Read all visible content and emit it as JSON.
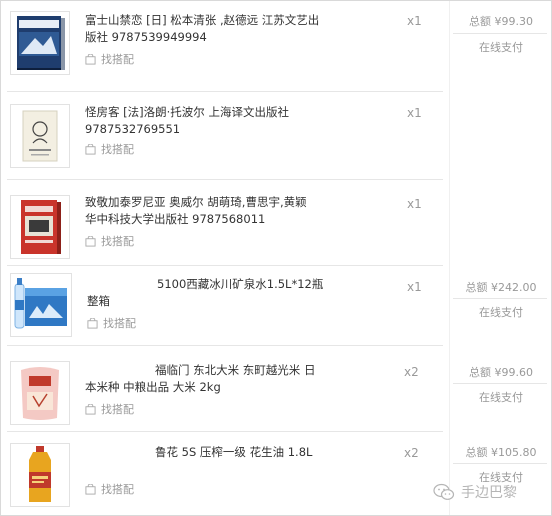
{
  "orders": [
    {
      "title": "富士山禁恋 [日] 松本清张 ,赵德远 江苏文艺出\n版社 9787539949994",
      "match_label": "找搭配",
      "quantity": "x1",
      "total": "总额 ¥99.30",
      "pay_status": "在线支付"
    },
    {
      "title": "怪房客 [法]洛朗·托波尔 上海译文出版社\n9787532769551",
      "match_label": "找搭配",
      "quantity": "x1"
    },
    {
      "title": "致敬加泰罗尼亚 奥威尔 胡萌琦,曹思宇,黄颖\n华中科技大学出版社 9787568011",
      "match_label": "找搭配",
      "quantity": "x1"
    },
    {
      "title": "5100西藏冰川矿泉水1.5L*12瓶\n整箱",
      "match_label": "找搭配",
      "quantity": "x1",
      "total": "总额 ¥242.00",
      "pay_status": "在线支付"
    },
    {
      "title": "福临门 东北大米 东町越光米 日\n本米种 中粮出品 大米 2kg",
      "match_label": "找搭配",
      "quantity": "x2",
      "total": "总额 ¥99.60",
      "pay_status": "在线支付"
    },
    {
      "title": "鲁花 5S 压榨一级 花生油 1.8L",
      "match_label": "找搭配",
      "quantity": "x2",
      "total": "总额 ¥105.80",
      "pay_status": "在线支付"
    }
  ],
  "watermark": {
    "text": "手边巴黎",
    "icon": "wechat-icon"
  }
}
